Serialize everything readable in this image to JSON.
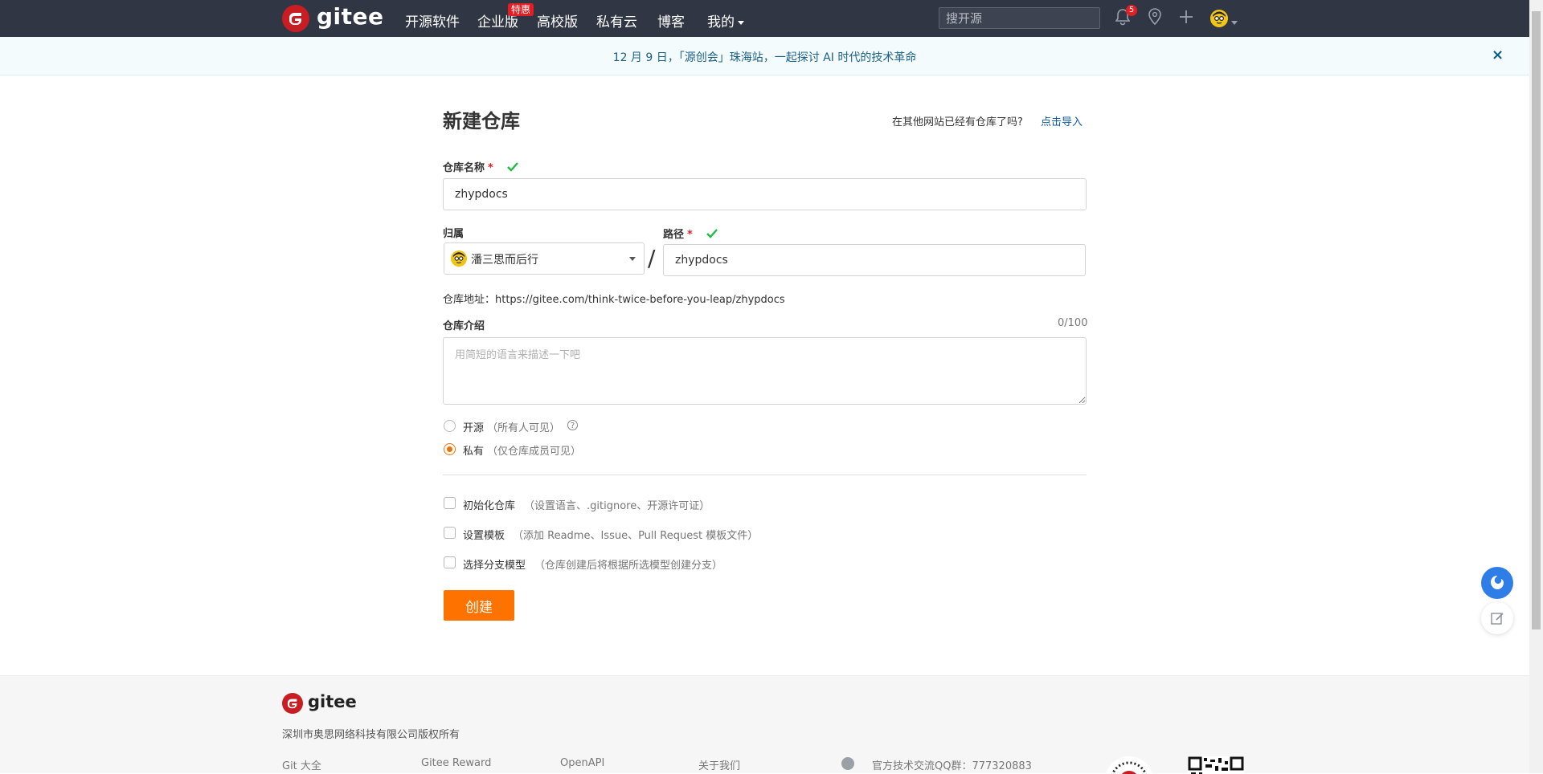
{
  "nav": {
    "logo_text": "gitee",
    "links": [
      "开源软件",
      "企业版",
      "高校版",
      "私有云",
      "博客",
      "我的"
    ],
    "enterprise_badge": "特惠",
    "search_placeholder": "搜开源",
    "notification_count": "5"
  },
  "announcement": {
    "text": "12 月 9 日，「源创会」珠海站，一起探讨 AI 时代的技术革命",
    "close": "×"
  },
  "form": {
    "title": "新建仓库",
    "import_prompt": "在其他网站已经有仓库了吗?",
    "import_link": "点击导入",
    "name_label": "仓库名称",
    "required_mark": "*",
    "name_value": "zhypdocs",
    "owner_label": "归属",
    "owner_value": "潘三思而后行",
    "separator": "/",
    "path_label": "路径",
    "path_value": "zhypdocs",
    "repo_address": "仓库地址：https://gitee.com/think-twice-before-you-leap/zhypdocs",
    "intro_label": "仓库介绍",
    "intro_counter": "0/100",
    "intro_placeholder": "用简短的语言来描述一下吧",
    "visibility": {
      "public_label": "开源",
      "public_hint": "（所有人可见）",
      "help": "?",
      "private_label": "私有",
      "private_hint": "（仅仓库成员可见）",
      "selected": "private"
    },
    "options": [
      {
        "label": "初始化仓库",
        "hint": "（设置语言、.gitignore、开源许可证）"
      },
      {
        "label": "设置模板",
        "hint": "（添加 Readme、Issue、Pull Request 模板文件）"
      },
      {
        "label": "选择分支模型",
        "hint": "（仓库创建后将根据所选模型创建分支）"
      }
    ],
    "create_button": "创建"
  },
  "footer": {
    "logo_text": "gitee",
    "copyright": "深圳市奥思网络科技有限公司版权所有",
    "links": [
      "Git 大全",
      "Gitee Reward",
      "OpenAPI",
      "关于我们"
    ],
    "qq_group": "官方技术交流QQ群：777320883"
  },
  "colors": {
    "nav_bg": "#303643",
    "brand_red": "#c71d23",
    "accent_orange": "#fe7300",
    "link_blue": "#0c5ba8",
    "success_green": "#21ba45",
    "float_blue": "#2f7ee8"
  },
  "icons": {
    "nav": [
      "bell-icon",
      "location-pin-icon",
      "plus-icon",
      "avatar"
    ],
    "floating": [
      "chat-assistant-icon",
      "feedback-edit-icon"
    ]
  }
}
